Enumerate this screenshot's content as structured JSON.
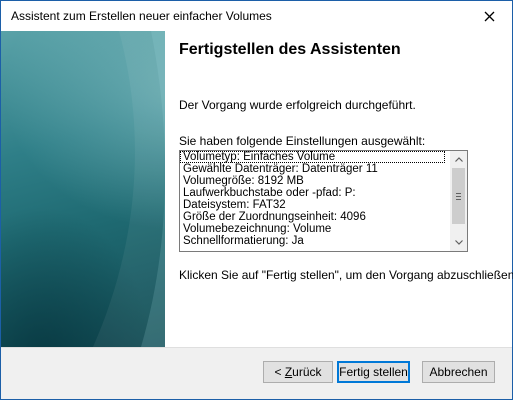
{
  "window": {
    "title": "Assistent zum Erstellen neuer einfacher Volumes",
    "close_icon": "close-icon"
  },
  "page": {
    "heading": "Fertigstellen des Assistenten",
    "success_text": "Der Vorgang wurde erfolgreich durchgeführt.",
    "settings_label": "Sie haben folgende Einstellungen ausgewählt:",
    "settings": [
      "Volumetyp: Einfaches Volume",
      "Gewählte Datenträger: Datenträger 11",
      "Volumegröße: 8192 MB",
      "Laufwerkbuchstabe oder -pfad: P:",
      "Dateisystem: FAT32",
      "Größe der Zuordnungseinheit: 4096",
      "Volumebezeichnung: Volume",
      "Schnellformatierung: Ja"
    ],
    "finish_hint": "Klicken Sie auf \"Fertig stellen\", um den Vorgang abzuschließen."
  },
  "buttons": {
    "back_label": "< Zurück",
    "back_accel": "Z",
    "finish_label": "Fertig stellen",
    "cancel_label": "Abbrechen"
  },
  "colors": {
    "panel_teal": "#1f6a72",
    "default_button_border": "#0078d7",
    "window_border": "#1c5fa8"
  }
}
